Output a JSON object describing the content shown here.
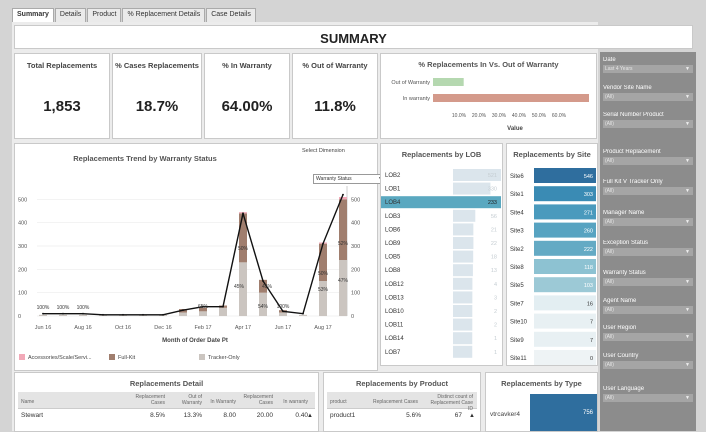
{
  "tabs": [
    "Summary",
    "Details",
    "Product",
    "% Replacement Details",
    "Case Details"
  ],
  "page_title": "SUMMARY",
  "kpis": [
    {
      "label": "Total Replacements",
      "value": "1,853"
    },
    {
      "label": "% Cases Replacements",
      "value": "18.7%"
    },
    {
      "label": "% In Warranty",
      "value": "64.00%"
    },
    {
      "label": "% Out of Warranty",
      "value": "11.8%"
    }
  ],
  "warranty_panel": {
    "title": "% Replacements In Vs. Out of Warranty",
    "xlabel": "Value",
    "colors": {
      "out": "#b5d8b0",
      "in": "#d49a8b"
    }
  },
  "trend": {
    "title": "Replacements Trend by Warranty Status",
    "select_label": "Select Dimension",
    "select_value": "Warranty Status",
    "xlabel": "Month of Order Date Pt",
    "legend": [
      {
        "label": "Accessories/Scale/Servi...",
        "color": "#f2a9b8"
      },
      {
        "label": "Full-Kit",
        "color": "#a07e6e"
      },
      {
        "label": "Tracker-Only",
        "color": "#cbc5c0"
      }
    ]
  },
  "lob_title": "Replacements by LOB",
  "site_title": "Replacements by Site",
  "filters_header": "Date",
  "filters": [
    {
      "label": "Date",
      "value": "Last 4 Years"
    },
    {
      "label": "Vendor Site Name",
      "value": "(All)"
    },
    {
      "label": "Serial Number Product",
      "value": "(All)"
    },
    {
      "label": "Product Replacement",
      "value": "(All)"
    },
    {
      "label": "Full Kit V Tracker Only",
      "value": "(All)"
    },
    {
      "label": "Manager Name",
      "value": "(All)"
    },
    {
      "label": "Exception Status",
      "value": "(All)"
    },
    {
      "label": "Warranty Status",
      "value": "(All)"
    },
    {
      "label": "Agent Name",
      "value": "(All)"
    },
    {
      "label": "User Region",
      "value": "(All)"
    },
    {
      "label": "User Country",
      "value": "(All)"
    },
    {
      "label": "User Language",
      "value": "(All)"
    }
  ],
  "detail": {
    "title": "Replacements Detail",
    "columns": [
      "Name",
      "Replacement Cases",
      "Out of Warranty",
      "In Warranty",
      "Replacement Cases",
      "In warranty"
    ],
    "rows": [
      [
        "Stewart",
        "8.5%",
        "13.3%",
        "8.00",
        "20.00",
        "0.40"
      ]
    ]
  },
  "product": {
    "title": "Replacements by Product",
    "columns": [
      "product",
      "Replacement Cases",
      "Distinct count of Replacement Case ID"
    ],
    "rows": [
      [
        "product1",
        "5.6%",
        "67"
      ]
    ]
  },
  "type": {
    "title": "Replacements by Type",
    "rows": [
      {
        "label": "vtrcavker4",
        "value": "756"
      }
    ]
  },
  "chart_data": [
    {
      "type": "bar",
      "title": "% Replacements In Vs. Out of Warranty",
      "xlabel": "Value",
      "categories": [
        "Out of Warranty",
        "In warranty"
      ],
      "values": [
        11.8,
        64.0
      ],
      "xlim": [
        0,
        60
      ],
      "xticks": [
        "10.0%",
        "20.0%",
        "30.0%",
        "40.0%",
        "50.0%",
        "60.0%"
      ]
    },
    {
      "type": "bar",
      "title": "Replacements Trend by Warranty Status",
      "xlabel": "Month of Order Date Pt",
      "x_ticks": [
        "Jun 16",
        "Aug 16",
        "Oct 16",
        "Dec 16",
        "Feb 17",
        "Apr 17",
        "Jun 17",
        "Aug 17"
      ],
      "y_ticks": [
        0,
        100,
        200,
        300,
        400,
        500
      ],
      "ylim": [
        0,
        540
      ],
      "series": [
        {
          "name": "Tracker-Only",
          "values": [
            5,
            5,
            5,
            5,
            5,
            5,
            5,
            15,
            20,
            35,
            230,
            100,
            15,
            5,
            150,
            240
          ]
        },
        {
          "name": "Full-Kit",
          "values": [
            0,
            0,
            0,
            0,
            0,
            0,
            0,
            15,
            15,
            10,
            210,
            55,
            10,
            0,
            160,
            260
          ]
        },
        {
          "name": "Accessories/Scale/Servi...",
          "values": [
            0,
            0,
            0,
            0,
            0,
            0,
            0,
            0,
            0,
            0,
            5,
            0,
            0,
            0,
            5,
            10
          ]
        }
      ],
      "line_total": [
        10,
        10,
        10,
        5,
        5,
        5,
        5,
        25,
        40,
        40,
        440,
        150,
        20,
        10,
        310,
        520
      ],
      "percent_labels": [
        "100%",
        "100%",
        "100%",
        "65%",
        "50%",
        "45%",
        "45%",
        "54%",
        "100%",
        "53%",
        "50%",
        "52%",
        "47%"
      ]
    },
    {
      "type": "bar",
      "title": "Replacements by LOB",
      "categories": [
        "LOB2",
        "LOB1",
        "LOB4",
        "LOB3",
        "LOB6",
        "LOB9",
        "LOB5",
        "LOB8",
        "LOB12",
        "LOB13",
        "LOB10",
        "LOB11",
        "LOB14",
        "LOB7"
      ],
      "values": [
        521,
        330,
        233,
        56,
        21,
        22,
        18,
        13,
        4,
        3,
        2,
        2,
        1,
        1
      ],
      "value_labels": [
        "521",
        "330",
        "233",
        "56",
        "21",
        "22",
        "18",
        "13",
        "4",
        "3",
        "2",
        "2",
        "1",
        "1"
      ]
    },
    {
      "type": "bar",
      "title": "Replacements by Site",
      "categories": [
        "Site6",
        "Site1",
        "Site4",
        "Site3",
        "Site2",
        "Site8",
        "Site5",
        "Site7",
        "Site10",
        "Site9",
        "Site11"
      ],
      "values": [
        546,
        303,
        271,
        260,
        222,
        118,
        103,
        16,
        7,
        7,
        0
      ]
    }
  ]
}
